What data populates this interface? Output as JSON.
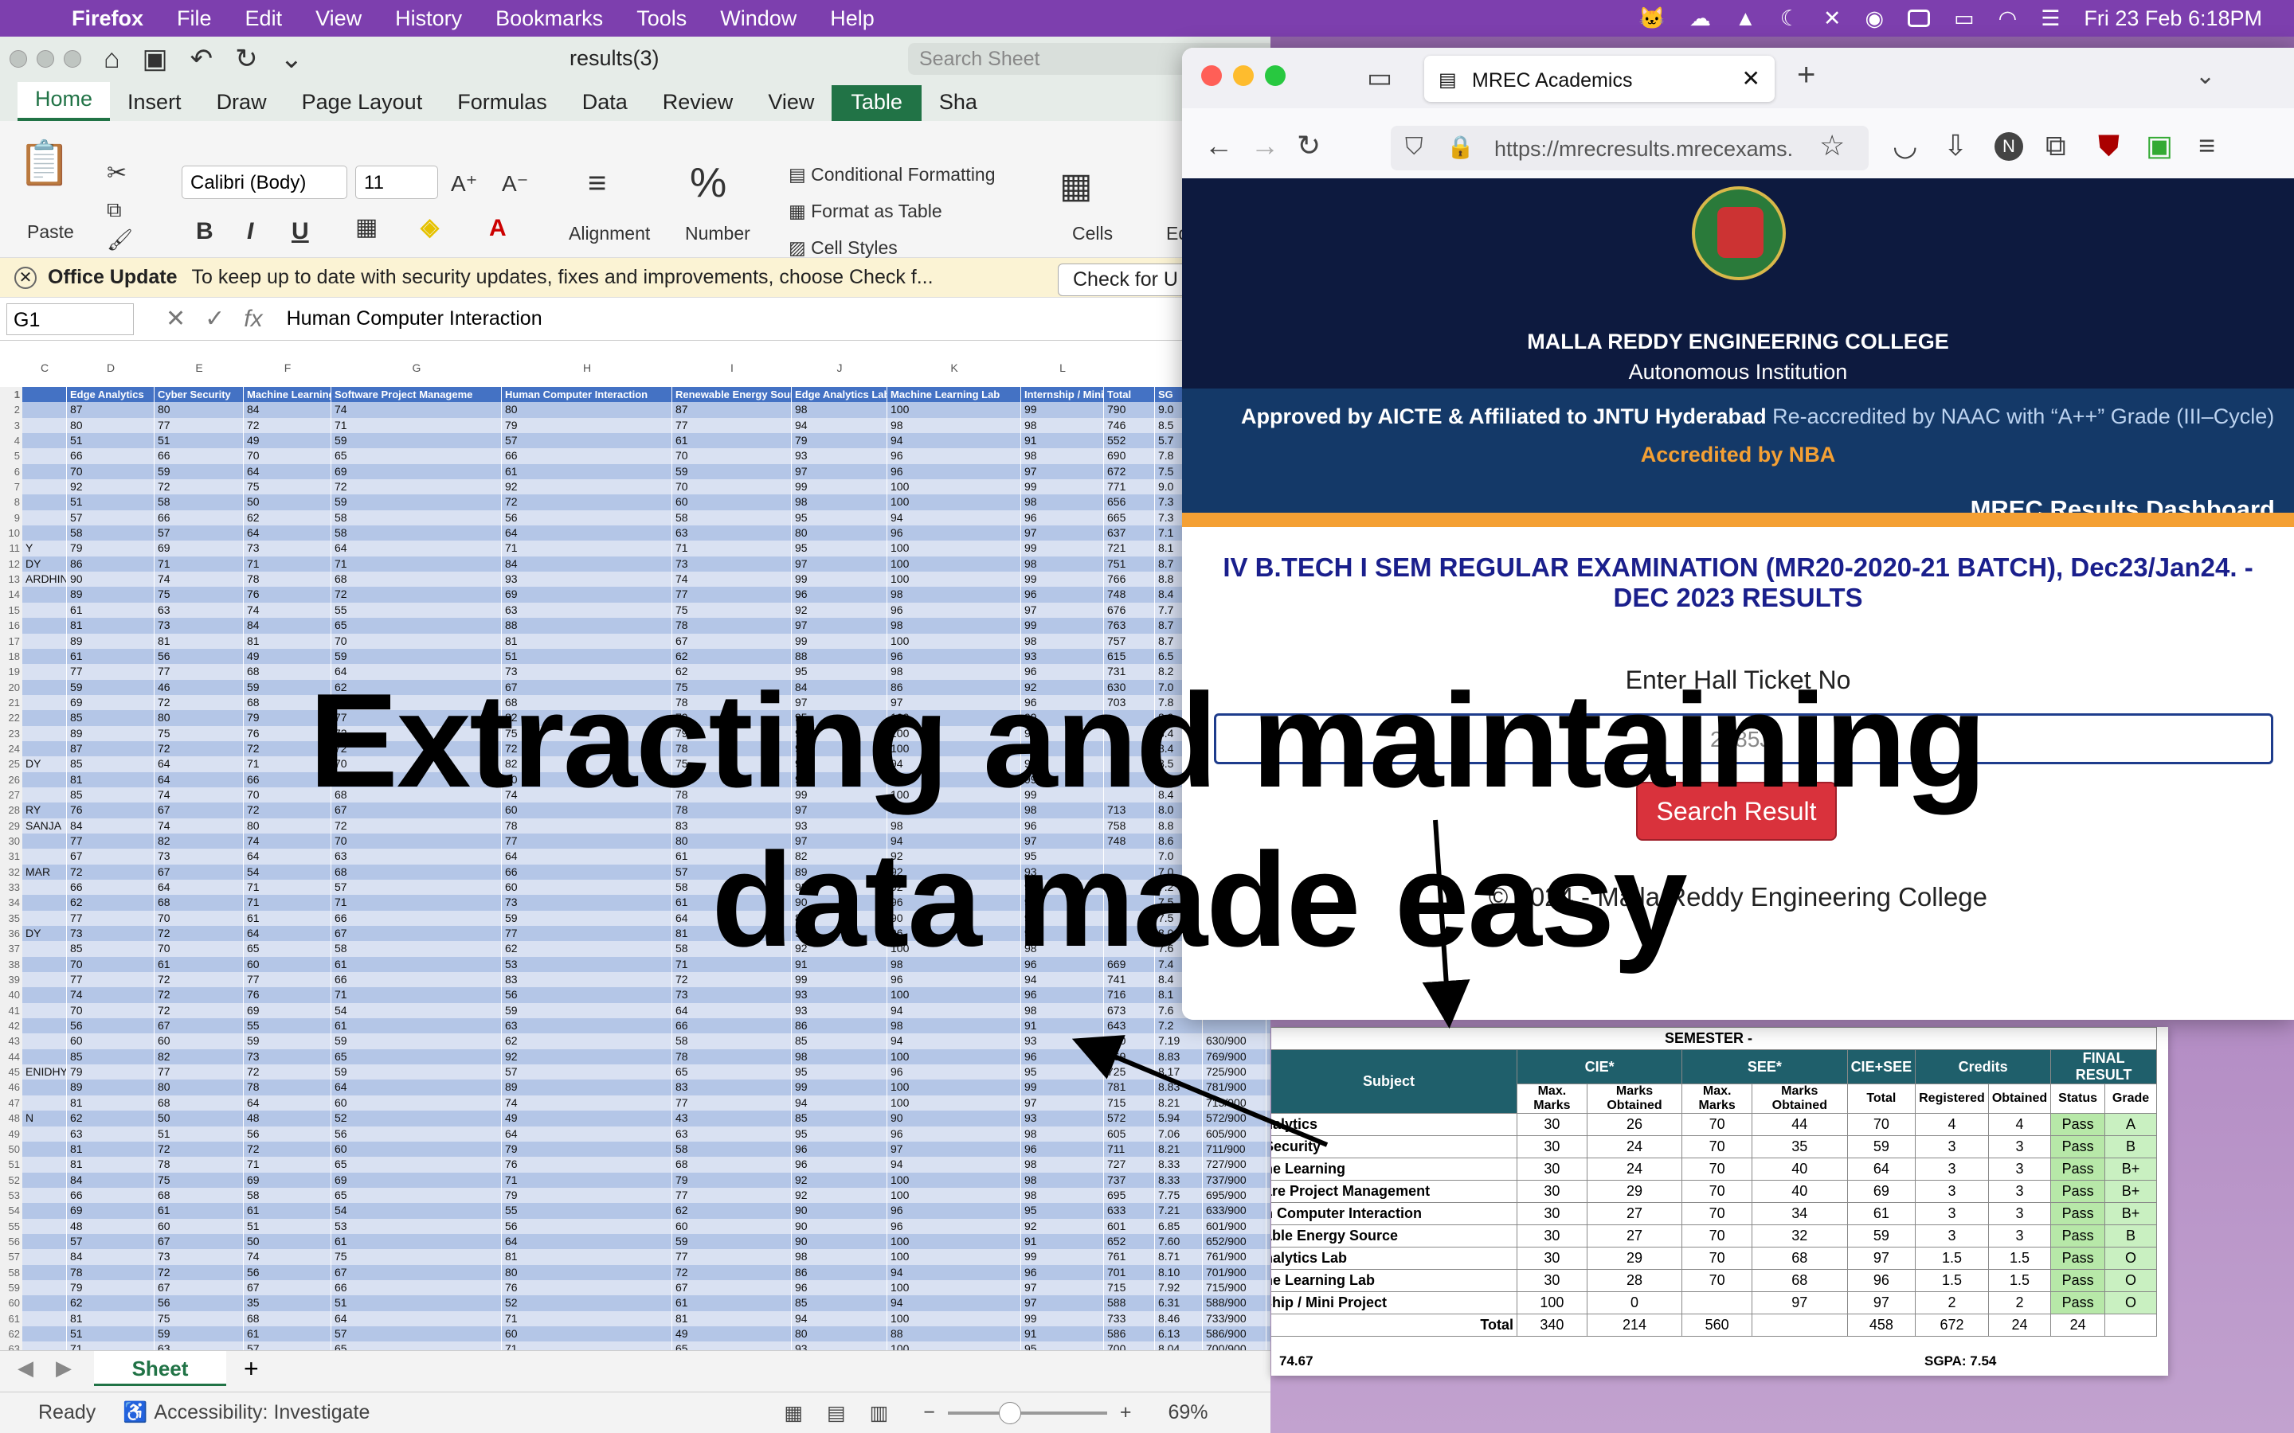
{
  "menubar": {
    "app": "Firefox",
    "items": [
      "File",
      "Edit",
      "View",
      "History",
      "Bookmarks",
      "Tools",
      "Window",
      "Help"
    ],
    "datetime": "Fri 23 Feb  6:18PM"
  },
  "excel": {
    "doc_title": "results(3)",
    "search_placeholder": "Search Sheet",
    "tabs": [
      "Home",
      "Insert",
      "Draw",
      "Page Layout",
      "Formulas",
      "Data",
      "Review",
      "View",
      "Table"
    ],
    "share": "Sha",
    "paste": "Paste",
    "font": "Calibri (Body)",
    "font_size": "11",
    "alignment": "Alignment",
    "number": "Number",
    "cond_fmt": "Conditional Formatting",
    "fmt_table": "Format as Table",
    "cell_styles": "Cell Styles",
    "cells": "Cells",
    "ed": "Ed",
    "update_title": "Office Update",
    "update_msg": "To keep up to date with security updates, fixes and improvements, choose Check f...",
    "update_btn": "Check for U",
    "cell_ref": "G1",
    "formula": "Human Computer Interaction",
    "col_letters": [
      "C",
      "D",
      "E",
      "F",
      "G",
      "H",
      "I",
      "J",
      "K",
      "L"
    ],
    "headers": [
      "Edge Analytics",
      "Cyber Security",
      "Machine Learning",
      "Software Project Manageme",
      "Human Computer Interaction",
      "Renewable Energy Source",
      "Edge Analytics Lab",
      "Machine Learning Lab",
      "Internship / Mini Project",
      "Total",
      "SG"
    ],
    "rows": [
      [
        "",
        "87",
        "80",
        "84",
        "74",
        "80",
        "87",
        "98",
        "100",
        "99",
        "790",
        "9.0"
      ],
      [
        "",
        "80",
        "77",
        "72",
        "71",
        "79",
        "77",
        "94",
        "98",
        "98",
        "746",
        "8.5"
      ],
      [
        "",
        "51",
        "51",
        "49",
        "59",
        "57",
        "61",
        "79",
        "94",
        "91",
        "552",
        "5.7"
      ],
      [
        "",
        "66",
        "66",
        "70",
        "65",
        "66",
        "70",
        "93",
        "96",
        "98",
        "690",
        "7.8"
      ],
      [
        "",
        "70",
        "59",
        "64",
        "69",
        "61",
        "59",
        "97",
        "96",
        "97",
        "672",
        "7.5"
      ],
      [
        "",
        "92",
        "72",
        "75",
        "72",
        "92",
        "70",
        "99",
        "100",
        "99",
        "771",
        "9.0"
      ],
      [
        "",
        "51",
        "58",
        "50",
        "59",
        "72",
        "60",
        "98",
        "100",
        "98",
        "656",
        "7.3"
      ],
      [
        "",
        "57",
        "66",
        "62",
        "58",
        "56",
        "58",
        "95",
        "94",
        "96",
        "665",
        "7.3"
      ],
      [
        "",
        "58",
        "57",
        "64",
        "58",
        "64",
        "63",
        "80",
        "96",
        "97",
        "637",
        "7.1"
      ],
      [
        "Y",
        "79",
        "69",
        "73",
        "64",
        "71",
        "71",
        "95",
        "100",
        "99",
        "721",
        "8.1"
      ],
      [
        "DY",
        "86",
        "71",
        "71",
        "71",
        "84",
        "73",
        "97",
        "100",
        "98",
        "751",
        "8.7"
      ],
      [
        "ARDHIN",
        "90",
        "74",
        "78",
        "68",
        "93",
        "74",
        "99",
        "100",
        "99",
        "766",
        "8.8"
      ],
      [
        "",
        "89",
        "75",
        "76",
        "72",
        "69",
        "77",
        "96",
        "98",
        "96",
        "748",
        "8.4"
      ],
      [
        "",
        "61",
        "63",
        "74",
        "55",
        "63",
        "75",
        "92",
        "96",
        "97",
        "676",
        "7.7"
      ],
      [
        "",
        "81",
        "73",
        "84",
        "65",
        "88",
        "78",
        "97",
        "98",
        "99",
        "763",
        "8.7"
      ],
      [
        "",
        "89",
        "81",
        "81",
        "70",
        "81",
        "67",
        "99",
        "100",
        "98",
        "757",
        "8.7"
      ],
      [
        "",
        "61",
        "56",
        "49",
        "59",
        "51",
        "62",
        "88",
        "96",
        "93",
        "615",
        "6.5"
      ],
      [
        "",
        "77",
        "77",
        "68",
        "64",
        "73",
        "62",
        "95",
        "98",
        "96",
        "731",
        "8.2"
      ],
      [
        "",
        "59",
        "46",
        "59",
        "62",
        "67",
        "75",
        "84",
        "86",
        "92",
        "630",
        "7.0"
      ],
      [
        "",
        "69",
        "72",
        "68",
        "63",
        "68",
        "78",
        "97",
        "97",
        "96",
        "703",
        "7.8"
      ],
      [
        "",
        "85",
        "80",
        "79",
        "77",
        "82",
        "79",
        "95",
        "100",
        "99",
        "",
        "8.9"
      ],
      [
        "",
        "89",
        "75",
        "76",
        "72",
        "75",
        "79",
        "96",
        "100",
        "99",
        "",
        "8.4"
      ],
      [
        "",
        "87",
        "72",
        "72",
        "72",
        "72",
        "78",
        "96",
        "100",
        "99",
        "",
        "8.4"
      ],
      [
        "DY",
        "85",
        "64",
        "71",
        "70",
        "82",
        "75",
        "98",
        "94",
        "94",
        "",
        "8.5"
      ],
      [
        "",
        "81",
        "64",
        "66",
        "68",
        "70",
        "74",
        "96",
        "100",
        "99",
        "",
        "8.2"
      ],
      [
        "",
        "85",
        "74",
        "70",
        "68",
        "74",
        "78",
        "99",
        "100",
        "99",
        "",
        "8.4"
      ],
      [
        "RY",
        "76",
        "67",
        "72",
        "67",
        "60",
        "78",
        "97",
        "98",
        "98",
        "713",
        "8.0"
      ],
      [
        "SANJA",
        "84",
        "74",
        "80",
        "72",
        "78",
        "83",
        "93",
        "98",
        "96",
        "758",
        "8.8"
      ],
      [
        "",
        "77",
        "82",
        "74",
        "70",
        "77",
        "80",
        "97",
        "94",
        "97",
        "748",
        "8.6"
      ],
      [
        "",
        "67",
        "73",
        "64",
        "63",
        "64",
        "61",
        "82",
        "92",
        "95",
        "",
        "7.0"
      ],
      [
        "MAR",
        "72",
        "67",
        "54",
        "68",
        "66",
        "57",
        "89",
        "92",
        "93",
        "",
        "7.0"
      ],
      [
        "",
        "66",
        "64",
        "71",
        "57",
        "60",
        "58",
        "92",
        "92",
        "98",
        "",
        "7.2"
      ],
      [
        "",
        "62",
        "68",
        "71",
        "71",
        "73",
        "61",
        "90",
        "96",
        "97",
        "",
        "7.5"
      ],
      [
        "",
        "77",
        "70",
        "61",
        "66",
        "59",
        "64",
        "89",
        "90",
        "92",
        "",
        "7.5"
      ],
      [
        "DY",
        "73",
        "72",
        "64",
        "67",
        "77",
        "81",
        "98",
        "96",
        "97",
        "",
        "8.0"
      ],
      [
        "",
        "85",
        "70",
        "65",
        "58",
        "62",
        "58",
        "92",
        "100",
        "98",
        "",
        "7.6"
      ],
      [
        "",
        "70",
        "61",
        "60",
        "61",
        "53",
        "71",
        "91",
        "98",
        "96",
        "669",
        "7.4"
      ],
      [
        "",
        "77",
        "72",
        "77",
        "66",
        "83",
        "72",
        "99",
        "96",
        "94",
        "741",
        "8.4"
      ],
      [
        "",
        "74",
        "72",
        "76",
        "71",
        "56",
        "73",
        "93",
        "100",
        "96",
        "716",
        "8.1"
      ],
      [
        "",
        "70",
        "72",
        "69",
        "54",
        "59",
        "64",
        "93",
        "94",
        "98",
        "673",
        "7.6"
      ],
      [
        "",
        "56",
        "67",
        "55",
        "61",
        "63",
        "66",
        "86",
        "98",
        "91",
        "643",
        "7.2"
      ],
      [
        "",
        "60",
        "60",
        "59",
        "59",
        "62",
        "58",
        "85",
        "94",
        "93",
        "630",
        "7.19"
      ],
      [
        "",
        "85",
        "82",
        "73",
        "65",
        "92",
        "78",
        "98",
        "100",
        "96",
        "769",
        "8.83"
      ],
      [
        "ENIDHY",
        "79",
        "77",
        "72",
        "59",
        "57",
        "65",
        "95",
        "96",
        "95",
        "725",
        "8.17"
      ],
      [
        "",
        "89",
        "80",
        "78",
        "64",
        "89",
        "83",
        "99",
        "100",
        "99",
        "781",
        "8.83"
      ],
      [
        "",
        "81",
        "68",
        "64",
        "60",
        "74",
        "77",
        "94",
        "100",
        "97",
        "715",
        "8.21"
      ],
      [
        "N",
        "62",
        "50",
        "48",
        "52",
        "49",
        "43",
        "85",
        "90",
        "93",
        "572",
        "5.94"
      ],
      [
        "",
        "63",
        "51",
        "56",
        "56",
        "64",
        "63",
        "95",
        "96",
        "98",
        "605",
        "7.06"
      ],
      [
        "",
        "81",
        "72",
        "72",
        "60",
        "79",
        "58",
        "96",
        "97",
        "96",
        "711",
        "8.21"
      ],
      [
        "",
        "81",
        "78",
        "71",
        "65",
        "76",
        "68",
        "96",
        "94",
        "98",
        "727",
        "8.33"
      ],
      [
        "",
        "84",
        "75",
        "69",
        "69",
        "71",
        "79",
        "92",
        "100",
        "98",
        "737",
        "8.33"
      ],
      [
        "",
        "66",
        "68",
        "58",
        "65",
        "79",
        "77",
        "92",
        "100",
        "98",
        "695",
        "7.75"
      ],
      [
        "",
        "69",
        "61",
        "61",
        "54",
        "55",
        "62",
        "90",
        "96",
        "95",
        "633",
        "7.21"
      ],
      [
        "",
        "48",
        "60",
        "51",
        "53",
        "56",
        "60",
        "90",
        "96",
        "92",
        "601",
        "6.85"
      ],
      [
        "",
        "57",
        "67",
        "50",
        "61",
        "64",
        "59",
        "90",
        "100",
        "91",
        "652",
        "7.60"
      ],
      [
        "",
        "84",
        "73",
        "74",
        "75",
        "81",
        "77",
        "98",
        "100",
        "99",
        "761",
        "8.71"
      ],
      [
        "",
        "78",
        "72",
        "56",
        "67",
        "80",
        "72",
        "86",
        "94",
        "96",
        "701",
        "8.10"
      ],
      [
        "",
        "79",
        "67",
        "67",
        "66",
        "76",
        "67",
        "96",
        "100",
        "97",
        "715",
        "7.92"
      ],
      [
        "",
        "62",
        "56",
        "35",
        "51",
        "52",
        "61",
        "85",
        "94",
        "97",
        "588",
        "6.31"
      ],
      [
        "",
        "81",
        "75",
        "68",
        "64",
        "71",
        "81",
        "94",
        "100",
        "99",
        "733",
        "8.46"
      ],
      [
        "",
        "51",
        "59",
        "61",
        "57",
        "60",
        "49",
        "80",
        "88",
        "91",
        "586",
        "6.13"
      ],
      [
        "",
        "71",
        "63",
        "57",
        "65",
        "71",
        "65",
        "93",
        "100",
        "95",
        "700",
        "8.04"
      ]
    ],
    "side_totals": [
      "",
      "",
      "",
      "",
      "",
      "",
      "",
      "",
      "",
      "",
      "",
      "",
      "",
      "",
      "",
      "",
      "",
      "",
      "",
      "",
      "",
      "",
      "",
      "",
      "",
      "",
      "",
      "",
      "",
      "",
      "",
      "",
      "",
      "",
      "",
      "",
      "",
      "",
      "",
      "",
      "",
      "630/900",
      "769/900",
      "725/900",
      "781/900",
      "715/900",
      "572/900",
      "605/900",
      "711/900",
      "727/900",
      "737/900",
      "695/900",
      "633/900",
      "601/900",
      "652/900",
      "761/900",
      "701/900",
      "715/900",
      "588/900",
      "733/900",
      "586/900",
      "700/900"
    ],
    "sheet_tab": "Sheet",
    "status_ready": "Ready",
    "status_accessibility": "Accessibility: Investigate",
    "zoom": "69%"
  },
  "firefox": {
    "tab_title": "MREC Academics",
    "url": "https://mrecresults.mrecexams.",
    "college": "MALLA REDDY ENGINEERING COLLEGE",
    "autonomous": "Autonomous Institution",
    "approved": "Approved by AICTE & Affiliated to JNTU Hyderabad",
    "reaccredited": "Re-accredited by NAAC with “A++” Grade (III–Cycle)",
    "nba": "Accredited by NBA",
    "dashboard": "MREC Results Dashboard",
    "exam_title": "IV B.TECH I SEM REGULAR EXAMINATION (MR20-2020-21 BATCH), Dec23/Jan24. - DEC 2023 RESULTS",
    "hall_ticket_label": "Enter Hall Ticket No",
    "hall_ticket_value": "2085J2",
    "search_btn": "Search Result",
    "copyright": "© 2024 - Malla Reddy Engineering College"
  },
  "result": {
    "semester": "SEMESTER -",
    "headers": {
      "subject": "Subject",
      "cie": "CIE*",
      "see": "SEE*",
      "ciesee": "CIE+SEE",
      "credits": "Credits",
      "final": "FINAL RESULT",
      "max": "Max. Marks",
      "obtained": "Marks Obtained",
      "total": "Total",
      "registered": "Registered",
      "obtained2": "Obtained",
      "status": "Status",
      "grade": "Grade"
    },
    "rows": [
      [
        "nalytics",
        "30",
        "26",
        "70",
        "44",
        "70",
        "4",
        "4",
        "Pass",
        "A"
      ],
      [
        "Security",
        "30",
        "24",
        "70",
        "35",
        "59",
        "3",
        "3",
        "Pass",
        "B"
      ],
      [
        "ne Learning",
        "30",
        "24",
        "70",
        "40",
        "64",
        "3",
        "3",
        "Pass",
        "B+"
      ],
      [
        "are Project Management",
        "30",
        "29",
        "70",
        "40",
        "69",
        "3",
        "3",
        "Pass",
        "B+"
      ],
      [
        "n Computer Interaction",
        "30",
        "27",
        "70",
        "34",
        "61",
        "3",
        "3",
        "Pass",
        "B+"
      ],
      [
        "able Energy Source",
        "30",
        "27",
        "70",
        "32",
        "59",
        "3",
        "3",
        "Pass",
        "B"
      ],
      [
        "nalytics Lab",
        "30",
        "29",
        "70",
        "68",
        "97",
        "1.5",
        "1.5",
        "Pass",
        "O"
      ],
      [
        "ne Learning Lab",
        "30",
        "28",
        "70",
        "68",
        "96",
        "1.5",
        "1.5",
        "Pass",
        "O"
      ],
      [
        "ship / Mini Project",
        "100",
        "0",
        "",
        "97",
        "97",
        "2",
        "2",
        "Pass",
        "O"
      ]
    ],
    "total_label": "Total",
    "totals": [
      "340",
      "214",
      "560",
      "458",
      "672",
      "24",
      "24"
    ],
    "foot_left": "74.67",
    "foot_right": "SGPA: 7.54"
  },
  "overlay": {
    "line1": "Extracting and maintaining",
    "line2": "data made easy"
  }
}
